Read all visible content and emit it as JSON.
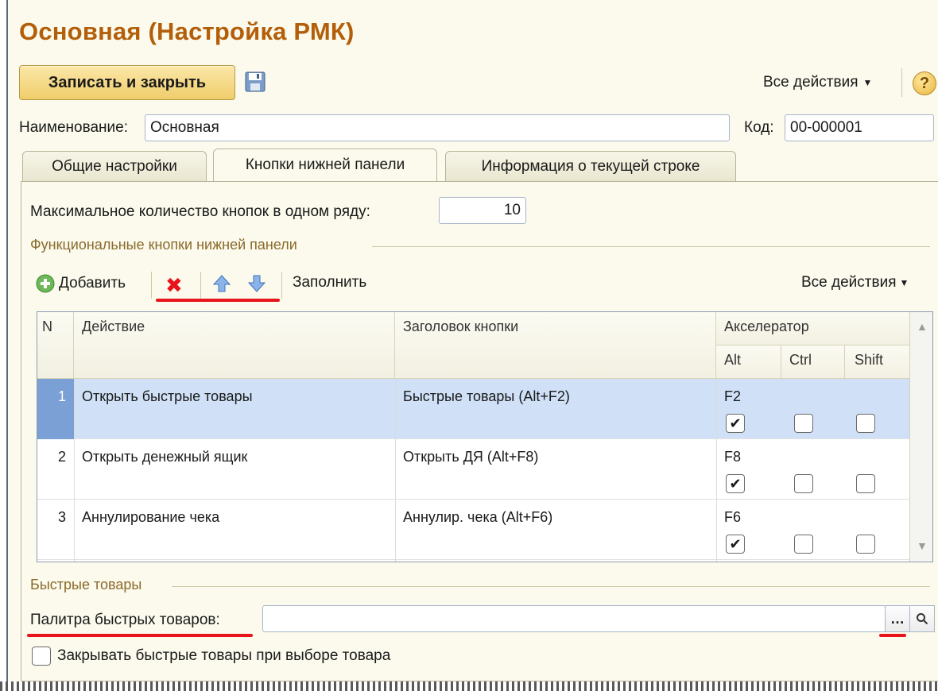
{
  "window": {
    "title": "Основная (Настройка РМК)"
  },
  "toolbar": {
    "save_close_label": "Записать и закрыть",
    "all_actions_label": "Все действия",
    "help_label": "?"
  },
  "form": {
    "name_label": "Наименование:",
    "name_value": "Основная",
    "code_label": "Код:",
    "code_value": "00-000001"
  },
  "tabs": [
    {
      "label": "Общие настройки"
    },
    {
      "label": "Кнопки нижней панели"
    },
    {
      "label": "Информация о текущей строке"
    }
  ],
  "panel": {
    "max_buttons_label": "Максимальное количество кнопок в одном ряду:",
    "max_buttons_value": "10",
    "func_group_title": "Функциональные кнопки нижней панели",
    "add_label": "Добавить",
    "fill_label": "Заполнить",
    "all_actions_label": "Все действия",
    "table": {
      "headers": {
        "n": "N",
        "action": "Действие",
        "caption": "Заголовок кнопки",
        "accelerator": "Акселератор",
        "alt": "Alt",
        "ctrl": "Ctrl",
        "shift": "Shift"
      },
      "rows": [
        {
          "n": "1",
          "action": "Открыть быстрые товары",
          "caption": "Быстрые товары (Alt+F2)",
          "key": "F2",
          "alt": true,
          "ctrl": false,
          "shift": false
        },
        {
          "n": "2",
          "action": "Открыть денежный ящик",
          "caption": "Открыть ДЯ (Alt+F8)",
          "key": "F8",
          "alt": true,
          "ctrl": false,
          "shift": false
        },
        {
          "n": "3",
          "action": "Аннулирование чека",
          "caption": "Аннулир. чека (Alt+F6)",
          "key": "F6",
          "alt": true,
          "ctrl": false,
          "shift": false
        }
      ]
    },
    "quick_group_title": "Быстрые товары",
    "palette_label": "Палитра быстрых товаров:",
    "palette_value": "",
    "close_on_select_label": "Закрывать быстрые товары при выборе товара"
  },
  "colors": {
    "title": "#b35f0a",
    "highlight_red": "#e8141c",
    "row_selected": "#cfe0f7"
  }
}
